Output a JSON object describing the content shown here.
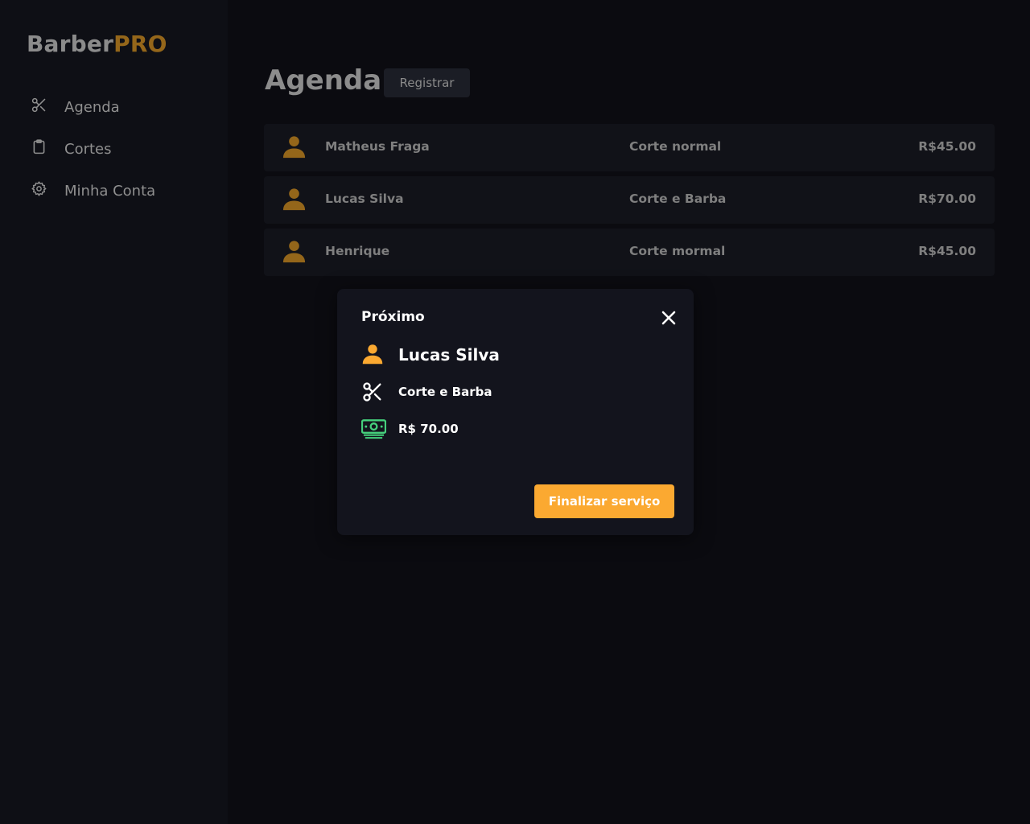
{
  "brand": {
    "part1": "Barber",
    "part2": "PRO"
  },
  "sidebar": {
    "items": [
      {
        "label": "Agenda",
        "icon": "scissors-icon"
      },
      {
        "label": "Cortes",
        "icon": "clipboard-icon"
      },
      {
        "label": "Minha Conta",
        "icon": "gear-icon"
      }
    ]
  },
  "main": {
    "title": "Agenda",
    "register_label": "Registrar",
    "rows": [
      {
        "name": "Matheus Fraga",
        "service": "Corte normal",
        "price": "R$45.00"
      },
      {
        "name": "Lucas Silva",
        "service": "Corte e Barba",
        "price": "R$70.00"
      },
      {
        "name": "Henrique",
        "service": "Corte mormal",
        "price": "R$45.00"
      }
    ]
  },
  "modal": {
    "title": "Próximo",
    "name": "Lucas Silva",
    "service": "Corte e Barba",
    "price": "R$ 70.00",
    "finish_label": "Finalizar serviço"
  },
  "colors": {
    "accent": "#fba931",
    "accent_dim": "#94661a",
    "money_green": "#45d07c",
    "background": "#0b0b10",
    "sidebar": "#0e0f15"
  }
}
